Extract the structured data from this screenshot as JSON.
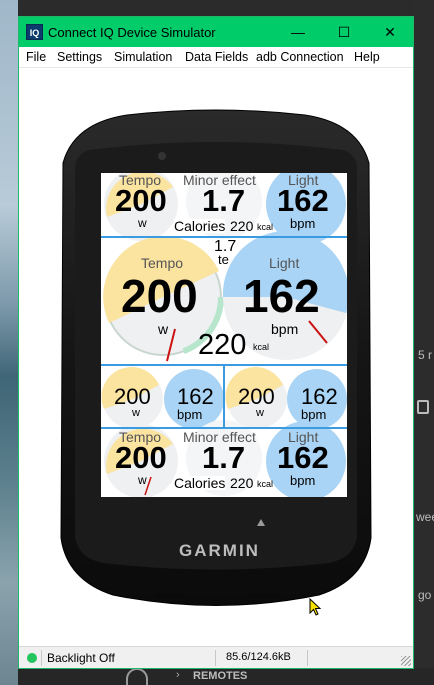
{
  "window": {
    "title": "Connect IQ Device Simulator",
    "app_icon": "IQ",
    "controls": {
      "minimize": "—",
      "maximize": "☐",
      "close": "✕"
    }
  },
  "menu": [
    "File",
    "Settings",
    "Simulation",
    "Data Fields",
    "adb Connection",
    "Help"
  ],
  "device": {
    "brand": "GARMIN"
  },
  "screen": {
    "row1": {
      "left": {
        "label": "Tempo",
        "value": "200",
        "unit": "w"
      },
      "middle": {
        "label": "Minor effect",
        "value": "1.7"
      },
      "right": {
        "label": "Light",
        "value": "162",
        "unit": "bpm"
      },
      "calories": {
        "label": "Calories",
        "value": "220",
        "unit": "kcal"
      }
    },
    "row2": {
      "left": {
        "label": "Tempo",
        "value": "200",
        "unit": "w"
      },
      "te": {
        "value": "1.7",
        "unit": "te"
      },
      "right": {
        "label": "Light",
        "value": "162",
        "unit": "bpm"
      },
      "calories": {
        "value": "220",
        "unit": "kcal"
      }
    },
    "row3": {
      "a": {
        "power": "200",
        "power_unit": "w",
        "hr": "162",
        "hr_unit": "bpm"
      },
      "b": {
        "power": "200",
        "power_unit": "w",
        "hr": "162",
        "hr_unit": "bpm"
      }
    },
    "row4": {
      "left": {
        "label": "Tempo",
        "value": "200",
        "unit": "w"
      },
      "middle": {
        "label": "Minor effect",
        "value": "1.7"
      },
      "right": {
        "label": "Light",
        "value": "162",
        "unit": "bpm"
      },
      "calories": {
        "label": "Calories",
        "value": "220",
        "unit": "kcal"
      }
    }
  },
  "status": {
    "indicator_color": "#22c55e",
    "backlight": "Backlight Off",
    "memory": "85.6/124.6kB"
  },
  "desktop": {
    "text_right_top": "5 r",
    "text_right_mid": "wee",
    "text_right_low": "go",
    "taskbar_label": "REMOTES"
  },
  "colors": {
    "power_zone": "#fbe3a0",
    "hr_zone": "#a9d4f5",
    "gauge_bg": "#eef0f2",
    "separator": "#3b9be0"
  }
}
